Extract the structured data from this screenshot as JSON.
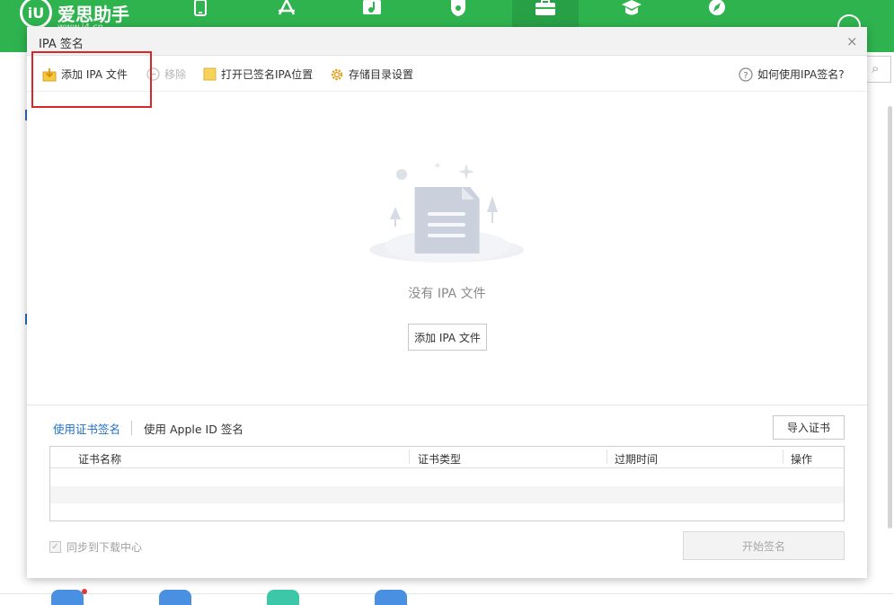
{
  "app": {
    "logo_mark": "iU",
    "logo_text": "爱思助手",
    "logo_url": "www.i4.cn",
    "nav_icons": [
      "phone-icon",
      "app-store-icon",
      "music-icon",
      "ringtone-icon",
      "toolbox-icon",
      "education-icon",
      "compass-icon"
    ]
  },
  "dialog": {
    "title": "IPA 签名",
    "close": "×",
    "toolbar": {
      "add_ipa": "添加 IPA 文件",
      "remove": "移除",
      "open_signed_location": "打开已签名IPA位置",
      "storage_settings": "存储目录设置",
      "help": "如何使用IPA签名?"
    },
    "empty_state": {
      "message": "没有 IPA 文件",
      "add_button": "添加 IPA 文件"
    },
    "tabs": {
      "cert_sign": "使用证书签名",
      "appleid_sign": "使用 Apple ID 签名"
    },
    "import_cert_button": "导入证书",
    "table": {
      "columns": [
        "证书名称",
        "证书类型",
        "过期时间",
        "操作"
      ],
      "rows": []
    },
    "sync_checkbox": {
      "label": "同步到下载中心",
      "checked": true
    },
    "start_button": "开始签名"
  },
  "colors": {
    "brand_green": "#2fb34f",
    "highlight_red": "#d9262b",
    "active_tab_blue": "#1e6fc4"
  }
}
